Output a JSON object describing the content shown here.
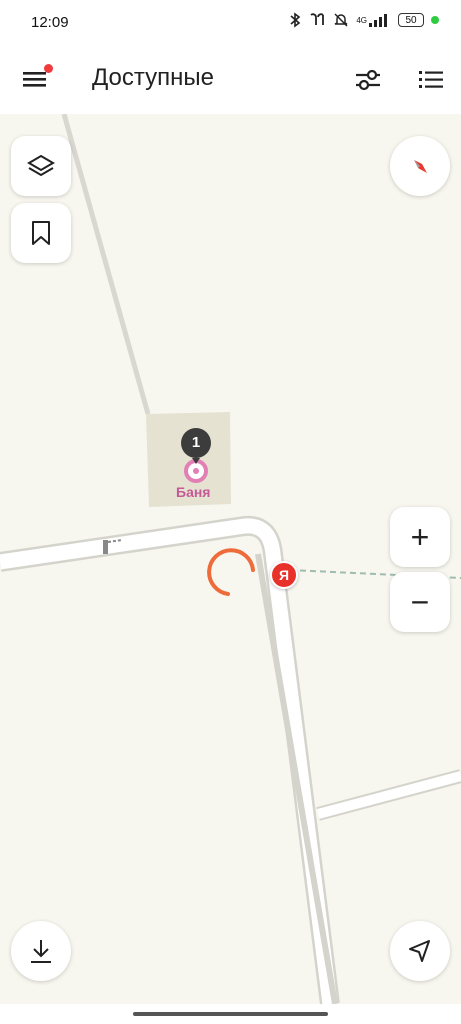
{
  "status_bar": {
    "time": "12:09",
    "battery": "50",
    "network": "4G",
    "icons": [
      "bluetooth-icon",
      "earbuds-icon",
      "mute-icon",
      "signal-icon",
      "battery-icon",
      "active-dot-icon"
    ]
  },
  "app_bar": {
    "title": "Доступные",
    "menu_icon": "hamburger-menu-icon",
    "filter_icon": "filter-sliders-icon",
    "list_icon": "list-icon"
  },
  "map": {
    "poi": {
      "count": "1",
      "label": "Баня",
      "icon": "bath-icon"
    },
    "yandex_marker": "Я",
    "controls": {
      "layers_icon": "layers-icon",
      "bookmarks_icon": "bookmark-icon",
      "compass_icon": "compass-icon",
      "zoom_in": "+",
      "zoom_out": "−",
      "download_icon": "download-icon",
      "locate_icon": "navigation-arrow-icon"
    },
    "colors": {
      "background": "#f7f7ef",
      "road": "#ffffff",
      "road_edge": "#d4d4cc",
      "building": "#e5e2d2",
      "poi_accent": "#c65a97",
      "loading_arc": "#ee6b3a",
      "yandex_red": "#e8312a"
    }
  }
}
